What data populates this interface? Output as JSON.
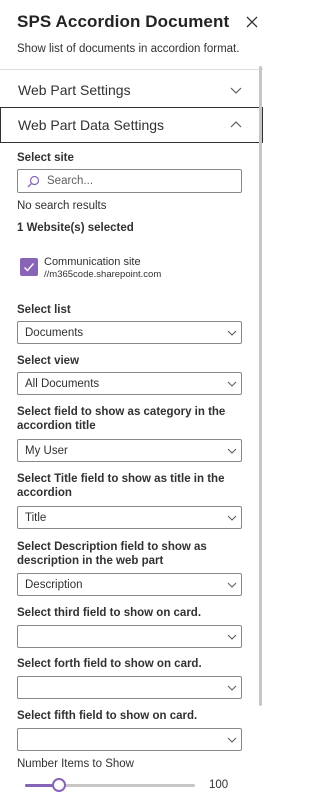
{
  "header": {
    "title": "SPS Accordion Document",
    "subtitle": "Show list of documents in accordion format."
  },
  "accordions": [
    {
      "label": "Web Part Settings",
      "expanded": false
    },
    {
      "label": "Web Part Data Settings",
      "expanded": true
    }
  ],
  "site": {
    "label": "Select site",
    "search_placeholder": "Search...",
    "no_results": "No search results",
    "selected_count": "1 Website(s) selected",
    "item_name": "Communication site",
    "item_url": "//m365code.sharepoint.com",
    "item_checked": true
  },
  "fields": [
    {
      "label": "Select list",
      "value": "Documents"
    },
    {
      "label": "Select view",
      "value": "All Documents"
    },
    {
      "label": "Select field to show as category in the accordion title",
      "value": "My User"
    },
    {
      "label": "Select Title field to show as title in the accordion",
      "value": "Title"
    },
    {
      "label": "Select Description field to show as description in the web part",
      "value": "Description"
    },
    {
      "label": "Select third field to show on card.",
      "value": ""
    },
    {
      "label": "Select forth field to show on card.",
      "value": ""
    },
    {
      "label": "Select fifth field to show on card.",
      "value": ""
    }
  ],
  "slider": {
    "label": "Number Items to Show",
    "value": "100",
    "fraction": 0.2
  },
  "colors": {
    "accent": "#8764b8",
    "border": "#8a8886",
    "text": "#323130"
  }
}
